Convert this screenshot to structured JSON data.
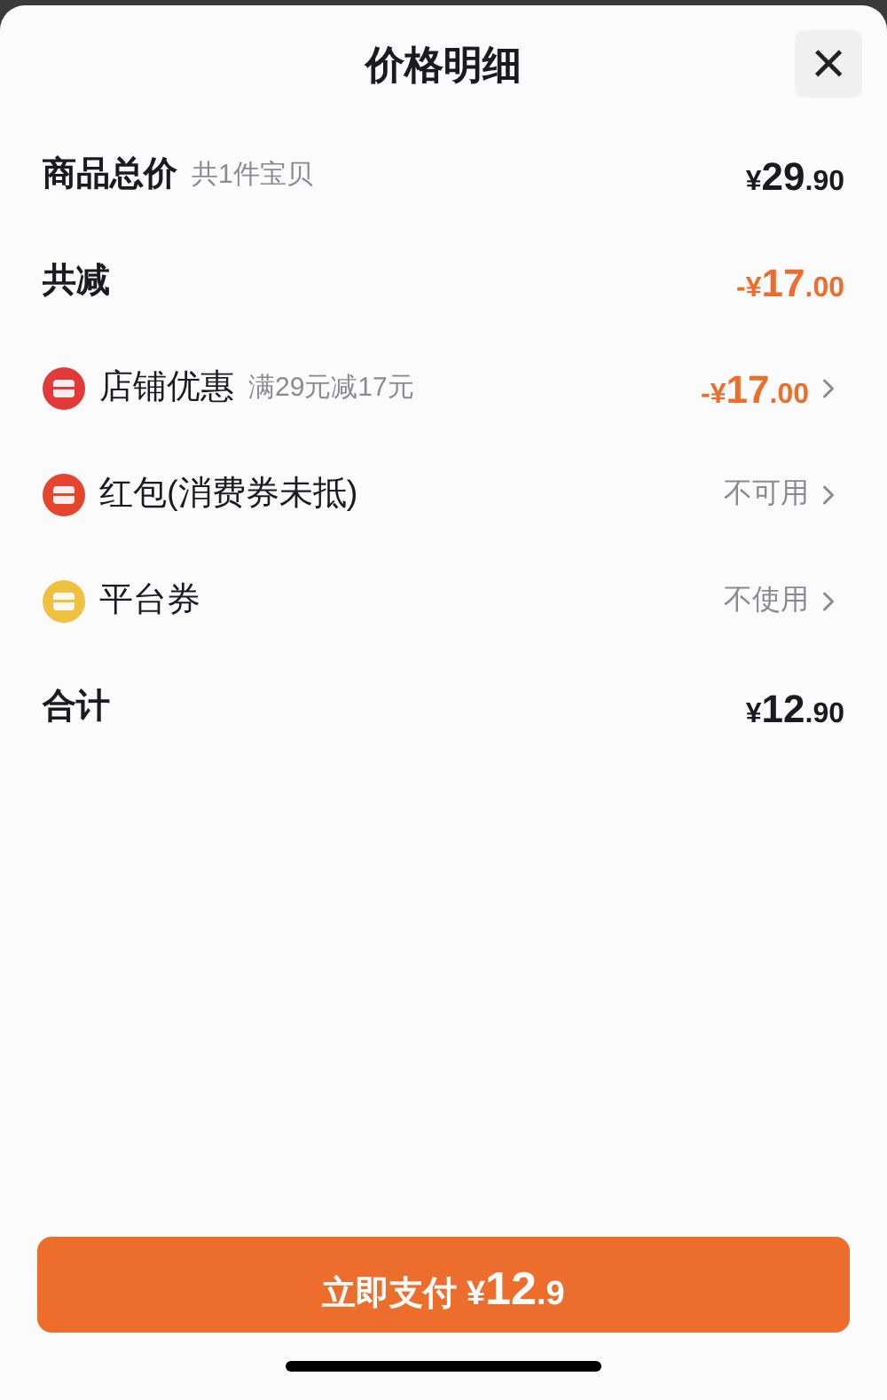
{
  "sheet": {
    "title": "价格明细",
    "close": "×"
  },
  "rows": [
    {
      "kind": "plain",
      "label": "商品总价",
      "note": "共1件宝贝",
      "price": {
        "currency": "¥",
        "integer": "29",
        "decimal": ".90"
      },
      "accent": false,
      "arrow": false
    },
    {
      "kind": "plain",
      "label": "共减",
      "price": {
        "sign": "-",
        "currency": "¥",
        "integer": "17",
        "decimal": ".00"
      },
      "accent": true,
      "arrow": false
    },
    {
      "kind": "icon",
      "color": "#e23a3a",
      "label": "店铺优惠",
      "note": "满29元减17元",
      "price": {
        "sign": "-",
        "currency": "¥",
        "integer": "17",
        "decimal": ".00"
      },
      "accent": true,
      "arrow": true
    },
    {
      "kind": "icon",
      "color": "#e5452f",
      "label": "红包(消费券未抵)",
      "value": "不可用",
      "accent": false,
      "arrow": true
    },
    {
      "kind": "icon",
      "color": "#f0c040",
      "label": "平台券",
      "value": "不使用",
      "accent": false,
      "arrow": true
    },
    {
      "kind": "plain",
      "label": "合计",
      "price": {
        "currency": "¥",
        "integer": "12",
        "decimal": ".90"
      },
      "accent": false,
      "arrow": false
    }
  ],
  "pay_button": {
    "label": "立即支付",
    "currency": "¥",
    "integer": "12",
    "decimal": ".9"
  }
}
